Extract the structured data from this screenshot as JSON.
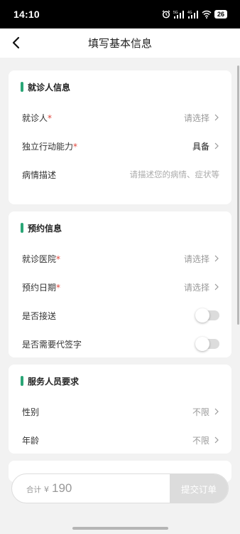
{
  "status_bar": {
    "time": "14:10",
    "battery": "26"
  },
  "header": {
    "title": "填写基本信息"
  },
  "patient_section": {
    "title": "就诊人信息",
    "rows": [
      {
        "label": "就诊人",
        "required": "*",
        "value": "请选择"
      },
      {
        "label": "独立行动能力",
        "required": "*",
        "value": "具备"
      },
      {
        "label": "病情描述",
        "placeholder": "请描述您的病情、症状等"
      }
    ]
  },
  "appointment_section": {
    "title": "预约信息",
    "rows": [
      {
        "label": "就诊医院",
        "required": "*",
        "value": "请选择"
      },
      {
        "label": "预约日期",
        "required": "*",
        "value": "请选择"
      },
      {
        "label": "是否接送",
        "toggle_on": false
      },
      {
        "label": "是否需要代签字",
        "toggle_on": false
      }
    ]
  },
  "staff_section": {
    "title": "服务人员要求",
    "rows": [
      {
        "label": "性别",
        "value": "不限"
      },
      {
        "label": "年龄",
        "value": "不限"
      }
    ]
  },
  "footer": {
    "total_label": "合计",
    "currency": "¥",
    "amount": "190",
    "submit_label": "提交订单"
  },
  "colors": {
    "accent": "#2aa676",
    "required": "#e0453a"
  }
}
